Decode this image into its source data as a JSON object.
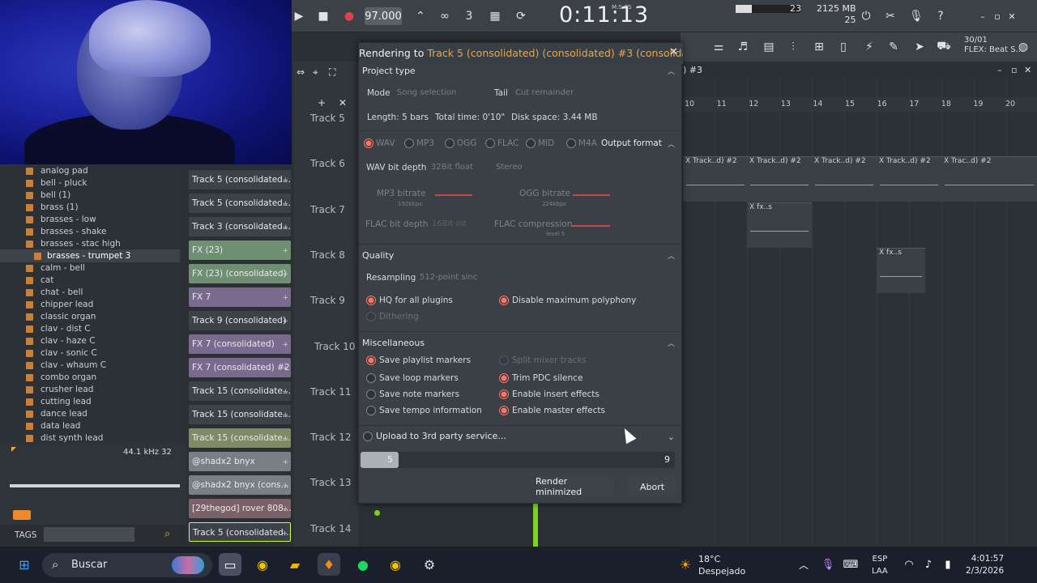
{
  "toolbar": {
    "tempo": "97.000",
    "time": "0:11:13",
    "time_label": "M:S:CS",
    "cpu_value": "23",
    "memory": "2125 MB",
    "polyphony": "25",
    "flex_counter": "30/01",
    "flex_label": "FLEX: Beat S..."
  },
  "browser": {
    "items": [
      "analog pad",
      "bell - pluck",
      "bell (1)",
      "brass (1)",
      "brasses - low",
      "brasses - shake",
      "brasses - stac high",
      "brasses - trumpet 3",
      "calm - bell",
      "cat",
      "chat - bell",
      "chipper lead",
      "classic organ",
      "clav - dist C",
      "clav - haze C",
      "clav - sonic C",
      "clav - whaum C",
      "combo organ",
      "crusher lead",
      "cutting lead",
      "dance lead",
      "data lead",
      "dist synth lead"
    ],
    "selected_index": 7
  },
  "sample_info": "44.1 kHz 32",
  "tags_label": "TAGS",
  "patterns": [
    {
      "label": "Track 5 (consolidated...",
      "color": "#3c4247"
    },
    {
      "label": "Track 5 (consolidated...",
      "color": "#3c4247"
    },
    {
      "label": "Track 3 (consolidated...",
      "color": "#3c4247"
    },
    {
      "label": "FX (23)",
      "color": "#6e8f72"
    },
    {
      "label": "FX (23) (consolidated)",
      "color": "#6e8f72"
    },
    {
      "label": "FX 7",
      "color": "#7a6b8e"
    },
    {
      "label": "Track 9 (consolidated)",
      "color": "#3c4247"
    },
    {
      "label": "FX 7 (consolidated)",
      "color": "#7a6b8e"
    },
    {
      "label": "FX 7 (consolidated) #2",
      "color": "#7a6b8e"
    },
    {
      "label": "Track 15 (consolidate...",
      "color": "#3c4247"
    },
    {
      "label": "Track 15 (consolidate...",
      "color": "#3c4247"
    },
    {
      "label": "Track 15 (consolidate...",
      "color": "#818a64"
    },
    {
      "label": "@shadx2 bnyx",
      "color": "#7a7f85"
    },
    {
      "label": "@shadx2 bnyx (cons...",
      "color": "#7a7f85"
    },
    {
      "label": "[29thegod] rover 808...",
      "color": "#7a6268"
    },
    {
      "label": "Track 5 (consolidated...",
      "color": "#3c4247"
    }
  ],
  "tracks": [
    "Track 5",
    "Track 6",
    "Track 7",
    "Track 8",
    "Track 9",
    "Track 10",
    "Track 11",
    "Track 12",
    "Track 13",
    "Track 14"
  ],
  "playlist": {
    "title": ") #3",
    "ruler": [
      "10",
      "11",
      "12",
      "13",
      "14",
      "15",
      "16",
      "17",
      "18",
      "19",
      "20"
    ],
    "clip_labels": [
      "X Track..d) #2",
      "X Track..d) #2",
      "X Track..d) #2",
      "X Track..d) #2",
      "X Trac..d) #2",
      "X fx..s",
      "X fx..s"
    ]
  },
  "dialog": {
    "title_prefix": "Rendering to ",
    "title_target": "Track 5 (consolidated) (consolidated) #3 (consolidat...",
    "project_type": "Project type",
    "mode_label": "Mode",
    "mode_value": "Song selection",
    "tail_label": "Tail",
    "tail_value": "Cut remainder",
    "length": "Length: 5 bars",
    "total_time": "Total time: 0'10\"",
    "disk_space": "Disk space: 3.44 MB",
    "formats": [
      "WAV",
      "MP3",
      "OGG",
      "FLAC",
      "MID",
      "M4A"
    ],
    "output_format": "Output format",
    "wav_bit_depth_label": "WAV bit depth",
    "wav_bit_depth_value": "32Bit float",
    "channels_value": "Stereo",
    "mp3_bitrate": "MP3 bitrate",
    "mp3_bitrate_value": "192kbps",
    "ogg_bitrate": "OGG bitrate",
    "ogg_bitrate_value": "224kbps",
    "flac_bit_depth": "FLAC bit depth",
    "flac_bit_depth_value": "16Bit int",
    "flac_compression": "FLAC compression",
    "flac_compression_value": "level 5",
    "quality": "Quality",
    "resampling_label": "Resampling",
    "resampling_value": "512-point sinc",
    "hq_plugins": "HQ for all plugins",
    "disable_polyphony": "Disable maximum polyphony",
    "dithering": "Dithering",
    "misc": "Miscellaneous",
    "opts_left": [
      "Save playlist markers",
      "Save loop markers",
      "Save note markers",
      "Save tempo information"
    ],
    "opts_right": [
      "Split mixer tracks",
      "Trim PDC silence",
      "Enable insert effects",
      "Enable master effects"
    ],
    "upload": "Upload to 3rd party service...",
    "progress_current": "5",
    "progress_total": "9",
    "progress_fraction": 0.12,
    "render_minimized": "Render minimized",
    "abort": "Abort"
  },
  "taskbar": {
    "search": "Buscar",
    "temp": "18°C",
    "weather": "Despejado",
    "lang1": "ESP",
    "lang2": "LAA",
    "time": "4:01:57",
    "date": "2/3/2026"
  },
  "colors": {
    "accent": "#f0a543",
    "active_radio": "#f37a6a",
    "playhead": "#7ed321"
  }
}
